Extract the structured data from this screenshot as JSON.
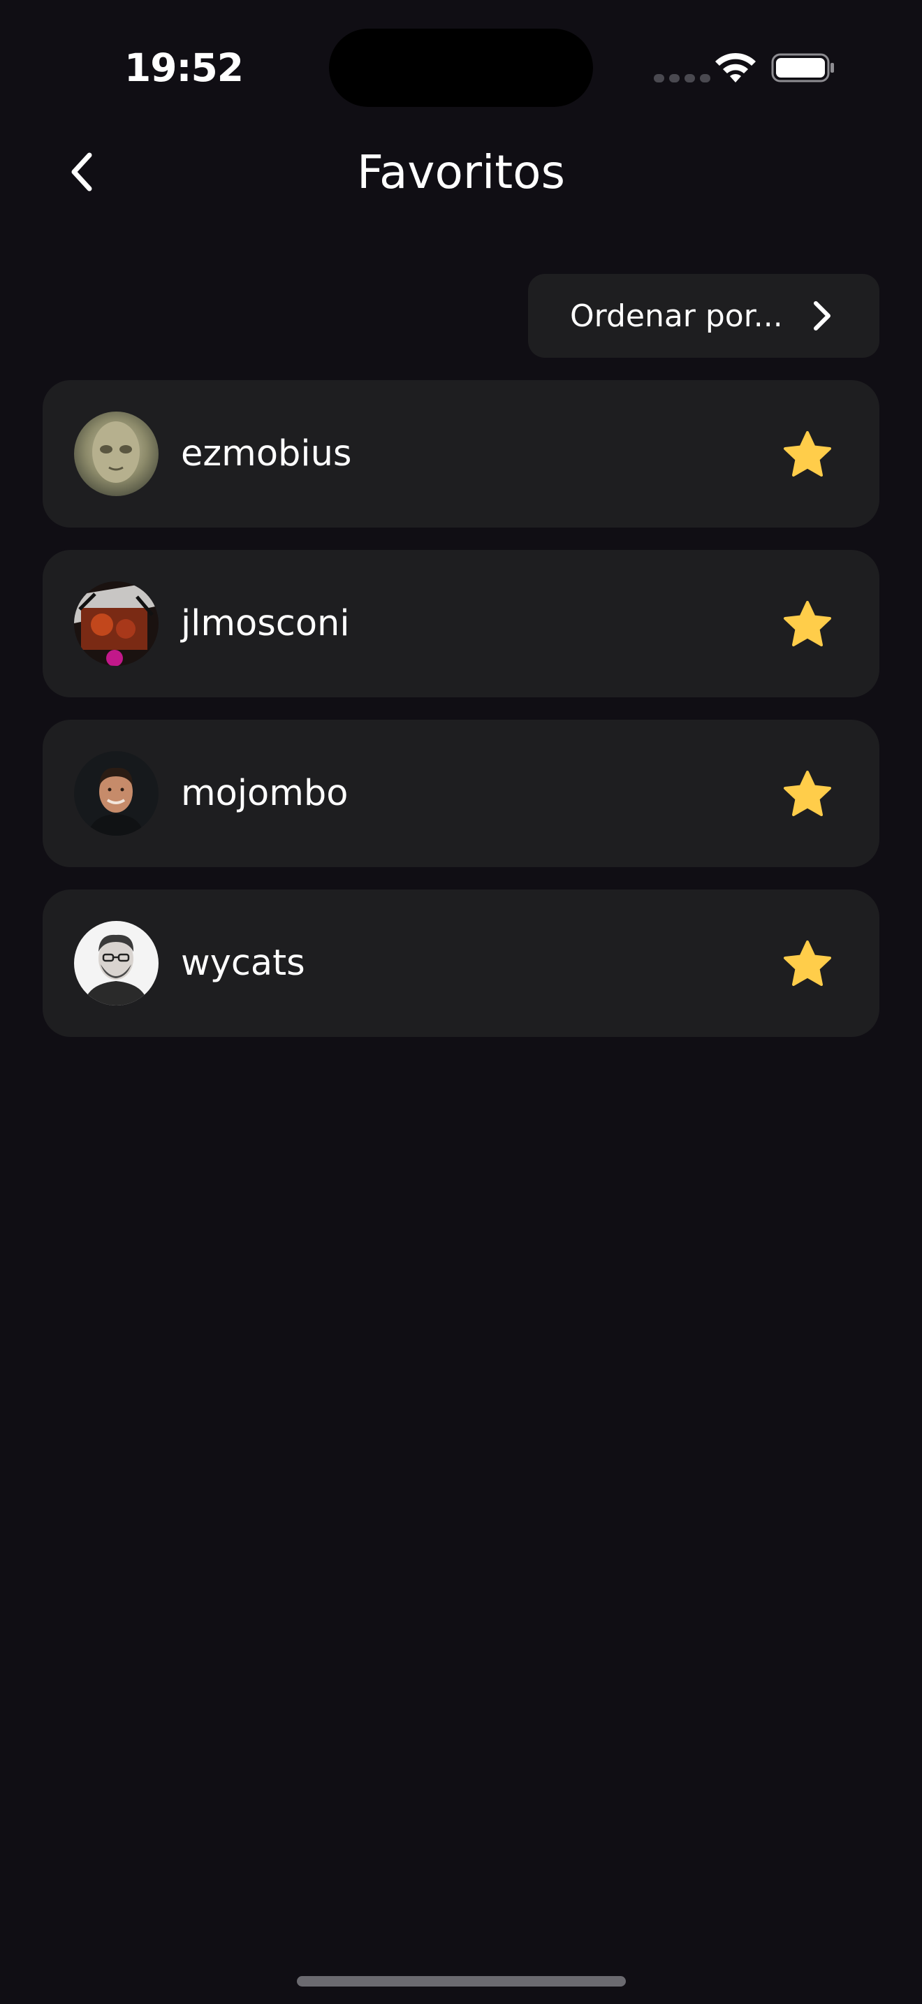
{
  "status_bar": {
    "time": "19:52",
    "icons": [
      "signal-icon",
      "wifi-icon",
      "battery-icon"
    ]
  },
  "header": {
    "title": "Favoritos",
    "back_icon": "chevron-left-icon"
  },
  "sort": {
    "label": "Ordenar por...",
    "icon": "chevron-right-icon"
  },
  "favorites": [
    {
      "username": "ezmobius",
      "avatar": "avatar-photo",
      "favorited": true
    },
    {
      "username": "jlmosconi",
      "avatar": "avatar-photo",
      "favorited": true
    },
    {
      "username": "mojombo",
      "avatar": "avatar-photo",
      "favorited": true
    },
    {
      "username": "wycats",
      "avatar": "avatar-photo",
      "favorited": true
    }
  ],
  "colors": {
    "background": "#100e14",
    "card": "#1e1e20",
    "star": "#ffcd4a",
    "text": "#ffffff"
  }
}
